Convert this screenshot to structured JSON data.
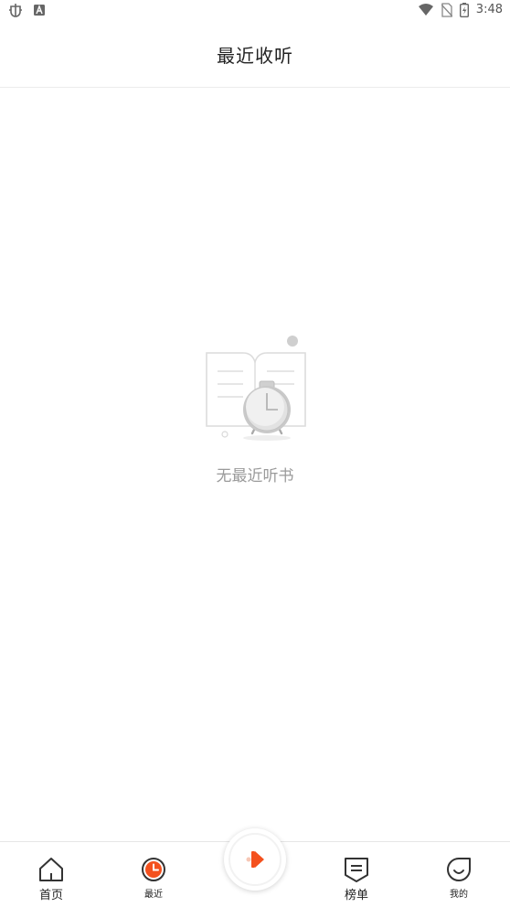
{
  "status_bar": {
    "time": "3:48",
    "left_icons": [
      "bug-icon",
      "a-badge-icon"
    ],
    "right_icons": [
      "wifi-icon",
      "no-sim-icon",
      "battery-charging-icon"
    ]
  },
  "header": {
    "title": "最近收听"
  },
  "empty_state": {
    "illustration": "book-clock-illustration",
    "message": "无最近听书"
  },
  "bottom_nav": {
    "items": [
      {
        "label": "首页",
        "icon": "home-icon",
        "active": false
      },
      {
        "label": "最近",
        "icon": "recent-clock-icon",
        "active": true
      },
      {
        "label": "",
        "icon": "play-icon",
        "active": false
      },
      {
        "label": "榜单",
        "icon": "ranking-icon",
        "active": false
      },
      {
        "label": "我的",
        "icon": "profile-icon",
        "active": false
      }
    ]
  },
  "colors": {
    "accent": "#f4511e",
    "text_primary": "#222222",
    "text_muted": "#9a9a9a",
    "divider": "#ececec"
  }
}
